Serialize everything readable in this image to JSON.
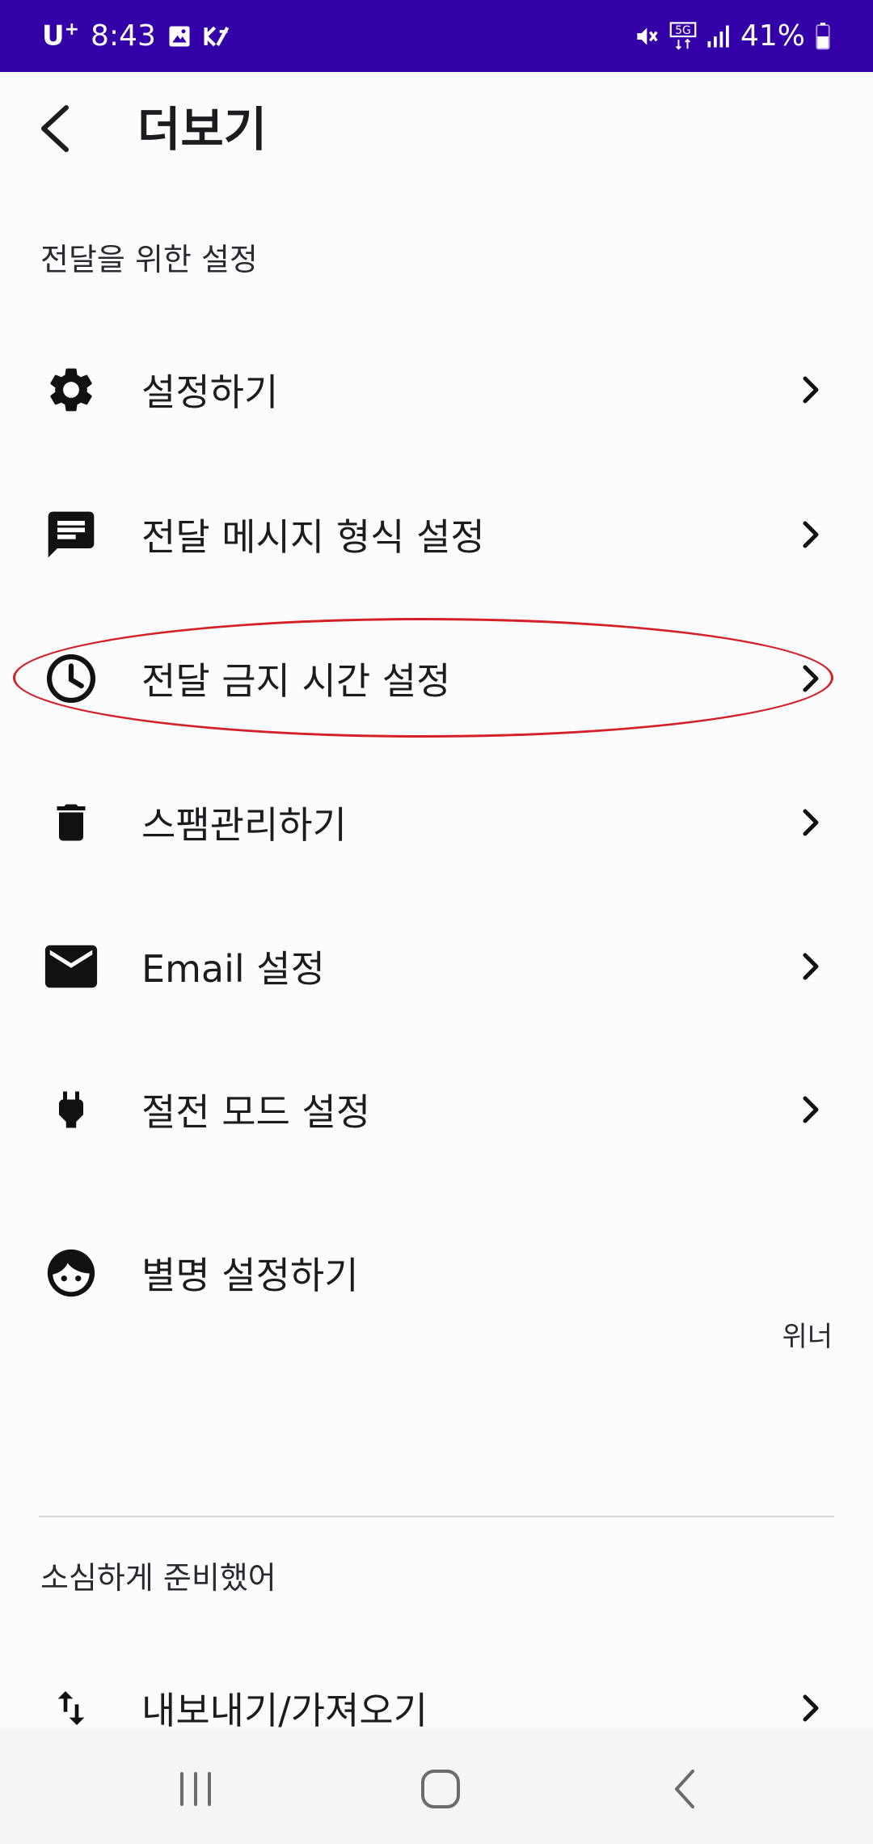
{
  "status_bar": {
    "carrier": "U",
    "carrier_sup": "+",
    "time": "8:43",
    "network": "5G",
    "battery": "41%"
  },
  "app_bar": {
    "title": "더보기"
  },
  "sections": [
    {
      "label": "전달을 위한 설정",
      "items": [
        {
          "label": "설정하기",
          "icon": "gear-icon"
        },
        {
          "label": "전달 메시지 형식 설정",
          "icon": "message-icon"
        },
        {
          "label": "전달 금지 시간 설정",
          "icon": "clock-icon"
        },
        {
          "label": "스팸관리하기",
          "icon": "trash-icon"
        },
        {
          "label": "Email 설정",
          "icon": "mail-icon"
        },
        {
          "label": "절전 모드 설정",
          "icon": "plug-icon"
        },
        {
          "label": "별명 설정하기",
          "icon": "face-icon",
          "value": "위너"
        }
      ]
    },
    {
      "label": "소심하게 준비했어",
      "items": [
        {
          "label": "내보내기/가져오기",
          "icon": "import-export-icon"
        }
      ]
    }
  ],
  "colors": {
    "status_bar": "#3400a8",
    "background": "#fcfbfd",
    "highlight_ring": "#d42027"
  }
}
